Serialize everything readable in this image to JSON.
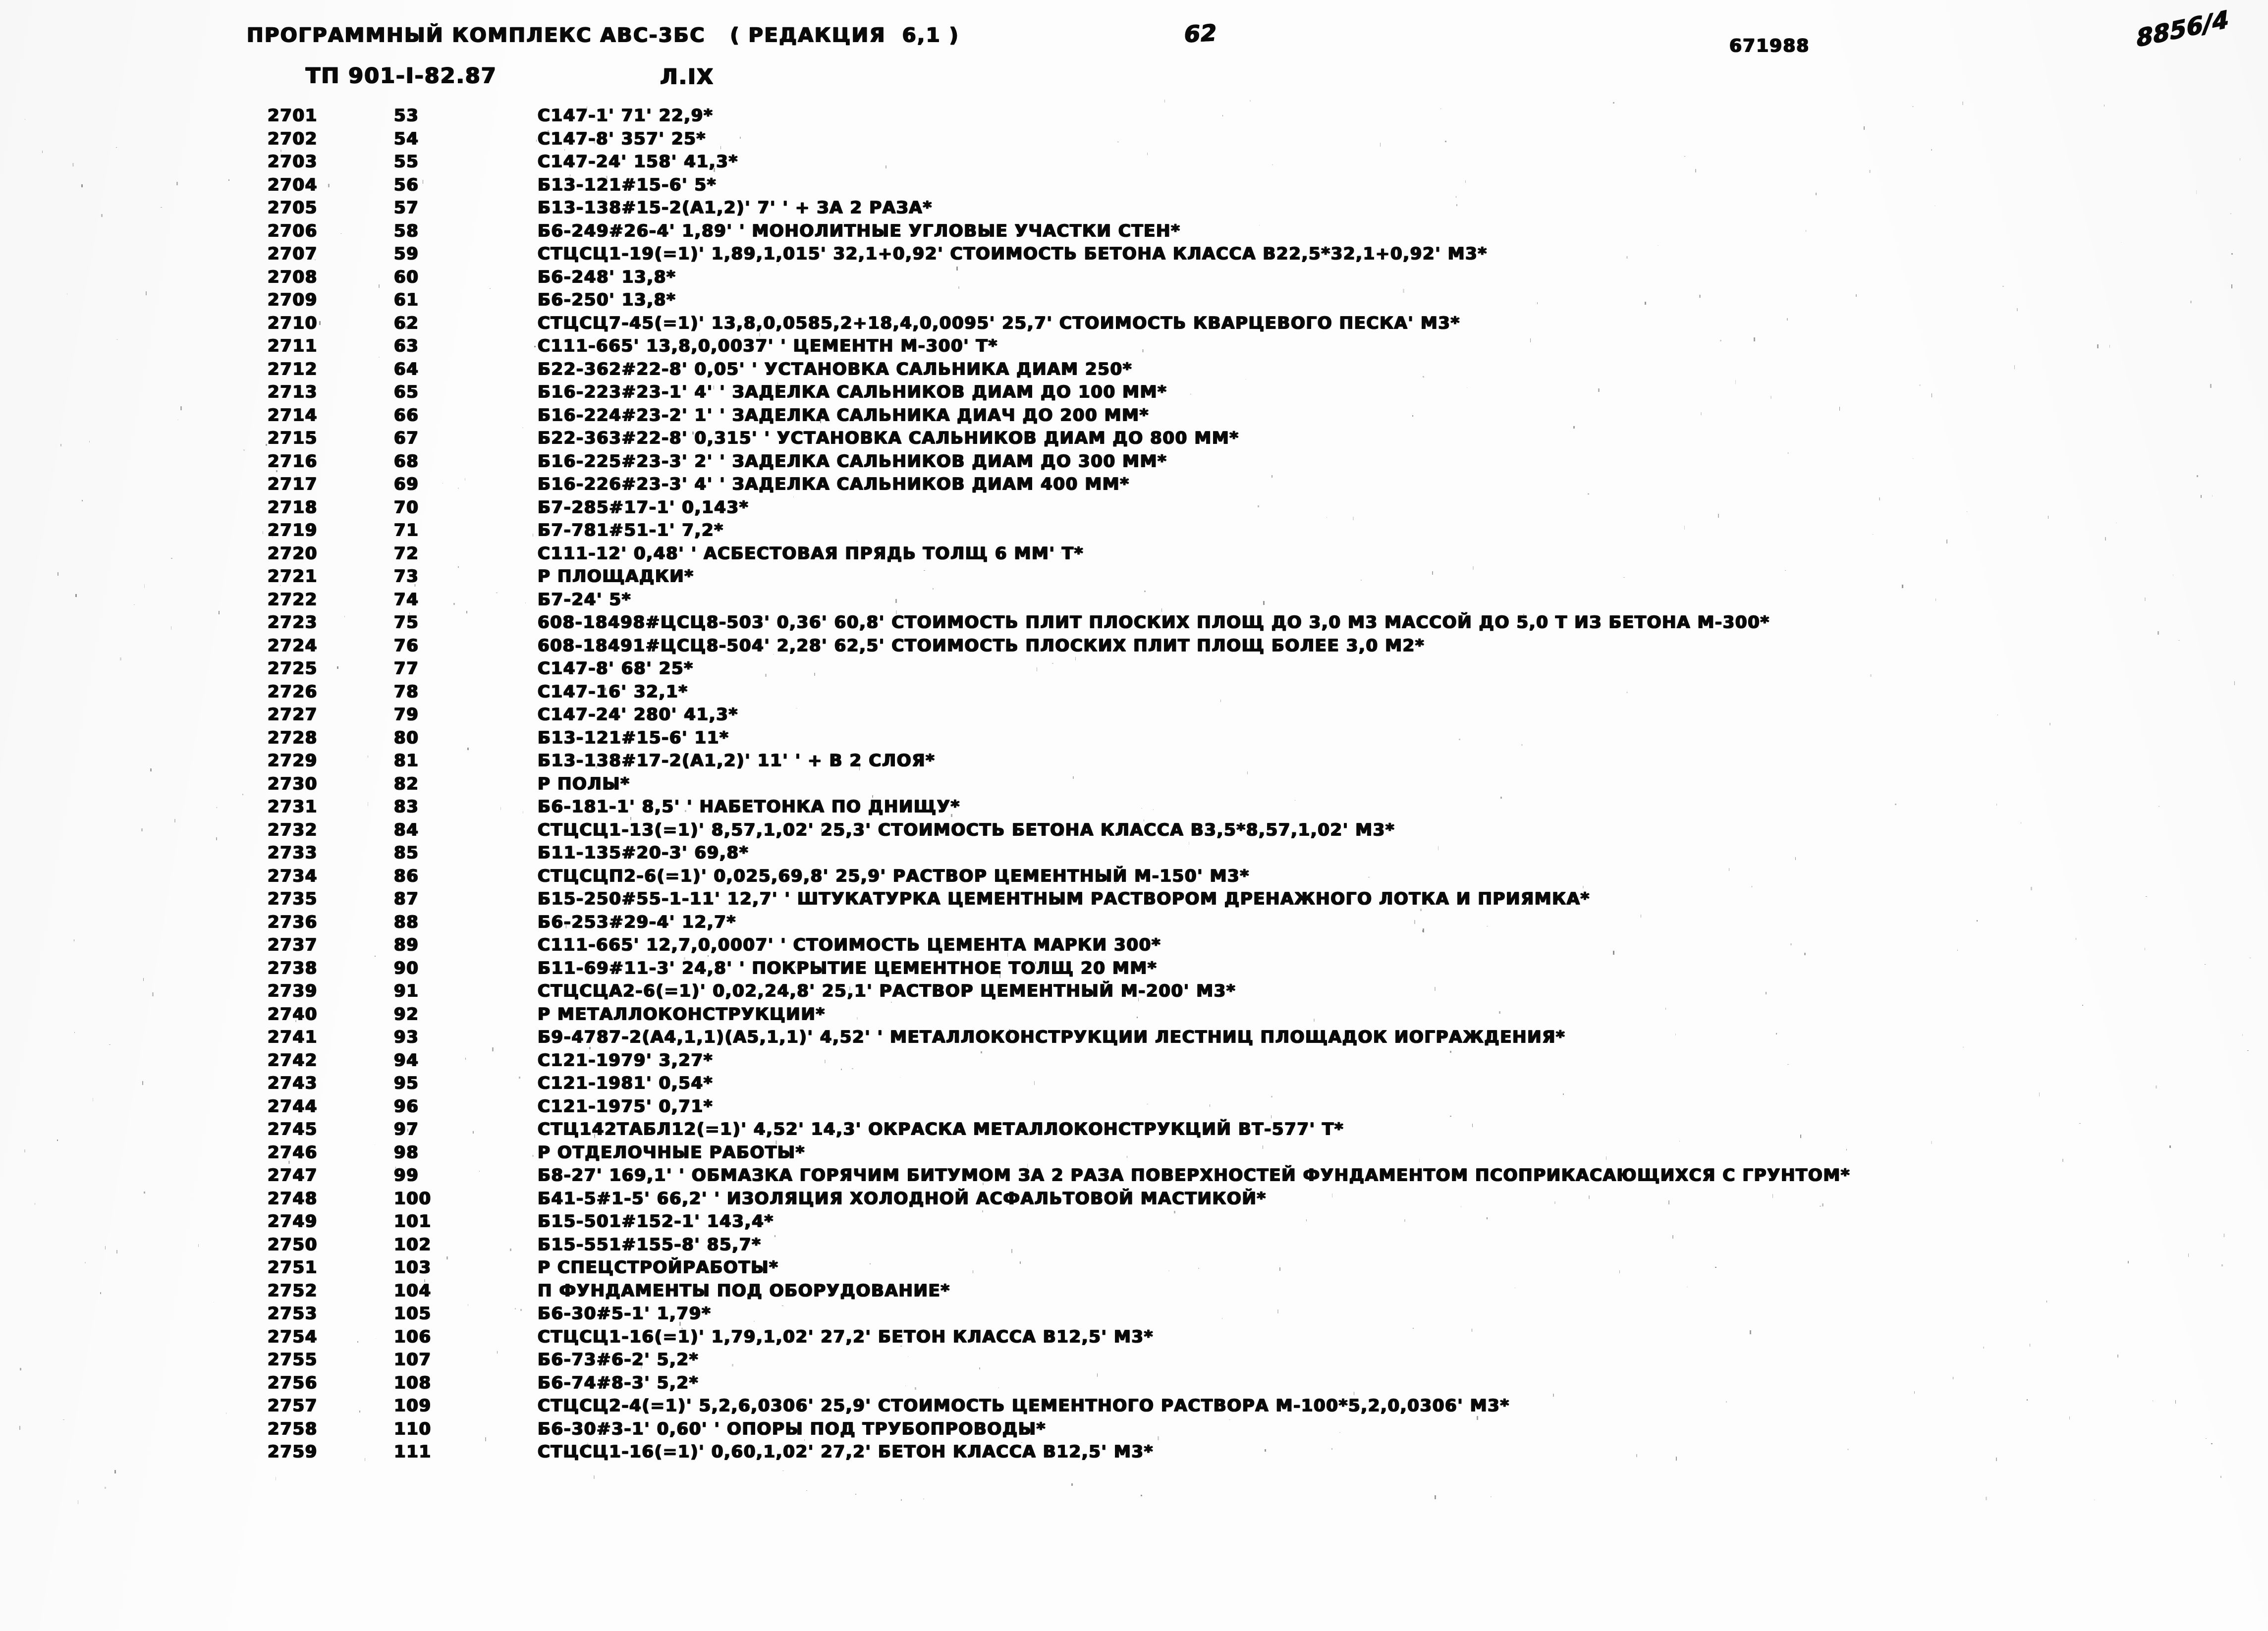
{
  "header": {
    "program_title": "ПРОГРАММНЫЙ КОМПЛЕКС АВС-3БС   ( РЕДАКЦИЯ  6,1 )",
    "ti_code": "ТП 901-I-82.87",
    "section_code": "Л.IX",
    "page_number": "62",
    "doc_number": "671988",
    "sheet_mark": "8856/4"
  },
  "columns": {
    "seq_header": "",
    "num_header": "",
    "text_header": ""
  },
  "rows": [
    {
      "seq": "2701",
      "num": "53",
      "text": "С147-1' 71' 22,9*"
    },
    {
      "seq": "2702",
      "num": "54",
      "text": "С147-8' 357' 25*"
    },
    {
      "seq": "2703",
      "num": "55",
      "text": "С147-24' 158' 41,3*"
    },
    {
      "seq": "2704",
      "num": "56",
      "text": "Б13-121#15-6' 5*"
    },
    {
      "seq": "2705",
      "num": "57",
      "text": "Б13-138#15-2(А1,2)' 7' ' + ЗА 2 РАЗА*"
    },
    {
      "seq": "2706",
      "num": "58",
      "text": "Б6-249#26-4' 1,89' ' МОНОЛИТНЫЕ УГЛОВЫЕ УЧАСТКИ СТЕН*"
    },
    {
      "seq": "2707",
      "num": "59",
      "text": "СТЦСЦ1-19(=1)' 1,89,1,015' 32,1+0,92' СТОИМОСТЬ БЕТОНА КЛАССА В22,5*32,1+0,92' М3*"
    },
    {
      "seq": "2708",
      "num": "60",
      "text": "Б6-248' 13,8*"
    },
    {
      "seq": "2709",
      "num": "61",
      "text": "Б6-250' 13,8*"
    },
    {
      "seq": "2710",
      "num": "62",
      "text": "СТЦСЦ7-45(=1)' 13,8,0,0585,2+18,4,0,0095' 25,7' СТОИМОСТЬ КВАРЦЕВОГО ПЕСКА' М3*"
    },
    {
      "seq": "2711",
      "num": "63",
      "text": "С111-665' 13,8,0,0037' ' ЦЕМЕНТН М-300' Т*"
    },
    {
      "seq": "2712",
      "num": "64",
      "text": "Б22-362#22-8' 0,05' ' УСТАНОВКА САЛЬНИКА ДИАМ 250*"
    },
    {
      "seq": "2713",
      "num": "65",
      "text": "Б16-223#23-1' 4' ' ЗАДЕЛКА САЛЬНИКОВ ДИАМ ДО 100 ММ*"
    },
    {
      "seq": "2714",
      "num": "66",
      "text": "Б16-224#23-2' 1' ' ЗАДЕЛКА САЛЬНИКА ДИАЧ ДО 200 ММ*"
    },
    {
      "seq": "2715",
      "num": "67",
      "text": "Б22-363#22-8' 0,315' ' УСТАНОВКА САЛЬНИКОВ ДИАМ ДО 800 ММ*"
    },
    {
      "seq": "2716",
      "num": "68",
      "text": "Б16-225#23-3' 2' ' ЗАДЕЛКА САЛЬНИКОВ ДИАМ ДО 300 ММ*"
    },
    {
      "seq": "2717",
      "num": "69",
      "text": "Б16-226#23-3' 4' ' ЗАДЕЛКА САЛЬНИКОВ ДИАМ 400 ММ*"
    },
    {
      "seq": "2718",
      "num": "70",
      "text": "Б7-285#17-1' 0,143*"
    },
    {
      "seq": "2719",
      "num": "71",
      "text": "Б7-781#51-1' 7,2*"
    },
    {
      "seq": "2720",
      "num": "72",
      "text": "С111-12' 0,48' ' АСБЕСТОВАЯ ПРЯДЬ ТОЛЩ 6 ММ' Т*"
    },
    {
      "seq": "2721",
      "num": "73",
      "text": "Р ПЛОЩАДКИ*"
    },
    {
      "seq": "2722",
      "num": "74",
      "text": "Б7-24' 5*"
    },
    {
      "seq": "2723",
      "num": "75",
      "text": "608-18498#ЦСЦ8-503' 0,36' 60,8' СТОИМОСТЬ ПЛИТ ПЛОСКИХ ПЛОЩ ДО 3,0 М3 МАССОЙ ДО 5,0 Т ИЗ БЕТОНА М-300*"
    },
    {
      "seq": "2724",
      "num": "76",
      "text": "608-18491#ЦСЦ8-504' 2,28' 62,5' СТОИМОСТЬ ПЛОСКИХ ПЛИТ ПЛОЩ БОЛЕЕ 3,0 М2*"
    },
    {
      "seq": "2725",
      "num": "77",
      "text": "С147-8' 68' 25*"
    },
    {
      "seq": "2726",
      "num": "78",
      "text": "С147-16' 32,1*"
    },
    {
      "seq": "2727",
      "num": "79",
      "text": "С147-24' 280' 41,3*"
    },
    {
      "seq": "2728",
      "num": "80",
      "text": "Б13-121#15-6' 11*"
    },
    {
      "seq": "2729",
      "num": "81",
      "text": "Б13-138#17-2(А1,2)' 11' ' + В 2 СЛОЯ*"
    },
    {
      "seq": "2730",
      "num": "82",
      "text": "Р ПОЛЫ*"
    },
    {
      "seq": "2731",
      "num": "83",
      "text": "Б6-181-1' 8,5' ' НАБЕТОНКА ПО ДНИЩУ*"
    },
    {
      "seq": "2732",
      "num": "84",
      "text": "СТЦСЦ1-13(=1)' 8,57,1,02' 25,3' СТОИМОСТЬ БЕТОНА КЛАССА В3,5*8,57,1,02' М3*"
    },
    {
      "seq": "2733",
      "num": "85",
      "text": "Б11-135#20-3' 69,8*"
    },
    {
      "seq": "2734",
      "num": "86",
      "text": "СТЦСЦП2-6(=1)' 0,025,69,8' 25,9' РАСТВОР ЦЕМЕНТНЫЙ М-150' М3*"
    },
    {
      "seq": "2735",
      "num": "87",
      "text": "Б15-250#55-1-11' 12,7' ' ШТУКАТУРКА ЦЕМЕНТНЫМ РАСТВОРОМ ДРЕНАЖНОГО ЛОТКА И ПРИЯМКА*"
    },
    {
      "seq": "2736",
      "num": "88",
      "text": "Б6-253#29-4' 12,7*"
    },
    {
      "seq": "2737",
      "num": "89",
      "text": "С111-665' 12,7,0,0007' ' СТОИМОСТЬ ЦЕМЕНТА МАРКИ 300*"
    },
    {
      "seq": "2738",
      "num": "90",
      "text": "Б11-69#11-3' 24,8' ' ПОКРЫТИЕ ЦЕМЕНТНОЕ ТОЛЩ 20 ММ*"
    },
    {
      "seq": "2739",
      "num": "91",
      "text": "СТЦСЦА2-6(=1)' 0,02,24,8' 25,1' РАСТВОР ЦЕМЕНТНЫЙ М-200' М3*"
    },
    {
      "seq": "2740",
      "num": "92",
      "text": "Р МЕТАЛЛОКОНСТРУКЦИИ*"
    },
    {
      "seq": "2741",
      "num": "93",
      "text": "Б9-4787-2(А4,1,1)(А5,1,1)' 4,52' ' МЕТАЛЛОКОНСТРУКЦИИ ЛЕСТНИЦ ПЛОЩАДОК ИОГРАЖДЕНИЯ*"
    },
    {
      "seq": "2742",
      "num": "94",
      "text": "С121-1979' 3,27*"
    },
    {
      "seq": "2743",
      "num": "95",
      "text": "С121-1981' 0,54*"
    },
    {
      "seq": "2744",
      "num": "96",
      "text": "С121-1975' 0,71*"
    },
    {
      "seq": "2745",
      "num": "97",
      "text": "СТЦ142ТАБЛ12(=1)' 4,52' 14,3' ОКРАСКА МЕТАЛЛОКОНСТРУКЦИЙ ВТ-577' Т*"
    },
    {
      "seq": "2746",
      "num": "98",
      "text": "Р ОТДЕЛОЧНЫЕ РАБОТЫ*"
    },
    {
      "seq": "2747",
      "num": "99",
      "text": "Б8-27' 169,1' ' ОБМАЗКА ГОРЯЧИМ БИТУМОМ ЗА 2 РАЗА ПОВЕРХНОСТЕЙ ФУНДАМЕНТОМ ПСОПРИКАСАЮЩИХСЯ С ГРУНТОМ*"
    },
    {
      "seq": "2748",
      "num": "100",
      "text": "Б41-5#1-5' 66,2' ' ИЗОЛЯЦИЯ ХОЛОДНОЙ АСФАЛЬТОВОЙ МАСТИКОЙ*"
    },
    {
      "seq": "2749",
      "num": "101",
      "text": "Б15-501#152-1' 143,4*"
    },
    {
      "seq": "2750",
      "num": "102",
      "text": "Б15-551#155-8' 85,7*"
    },
    {
      "seq": "2751",
      "num": "103",
      "text": "Р СПЕЦСТРОЙРАБОТЫ*"
    },
    {
      "seq": "2752",
      "num": "104",
      "text": "П ФУНДАМЕНТЫ ПОД ОБОРУДОВАНИЕ*"
    },
    {
      "seq": "2753",
      "num": "105",
      "text": "Б6-30#5-1' 1,79*"
    },
    {
      "seq": "2754",
      "num": "106",
      "text": "СТЦСЦ1-16(=1)' 1,79,1,02' 27,2' БЕТОН КЛАССА В12,5' М3*"
    },
    {
      "seq": "2755",
      "num": "107",
      "text": "Б6-73#6-2' 5,2*"
    },
    {
      "seq": "2756",
      "num": "108",
      "text": "Б6-74#8-3' 5,2*"
    },
    {
      "seq": "2757",
      "num": "109",
      "text": "СТЦСЦ2-4(=1)' 5,2,6,0306' 25,9' СТОИМОСТЬ ЦЕМЕНТНОГО РАСТВОРА М-100*5,2,0,0306' М3*"
    },
    {
      "seq": "2758",
      "num": "110",
      "text": "Б6-30#3-1' 0,60' ' ОПОРЫ ПОД ТРУБОПРОВОДЫ*"
    },
    {
      "seq": "2759",
      "num": "111",
      "text": "СТЦСЦ1-16(=1)' 0,60,1,02' 27,2' БЕТОН КЛАССА В12,5' М3*"
    }
  ]
}
